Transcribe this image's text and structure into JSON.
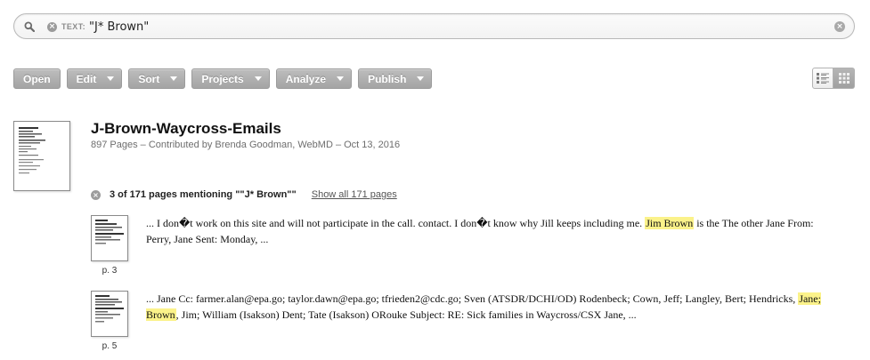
{
  "search": {
    "token_label": "TEXT:",
    "token_value": "\"J* Brown\""
  },
  "toolbar": {
    "buttons": [
      {
        "label": "Open"
      },
      {
        "label": "Edit"
      },
      {
        "label": "Sort"
      },
      {
        "label": "Projects"
      },
      {
        "label": "Analyze"
      },
      {
        "label": "Publish"
      }
    ]
  },
  "document": {
    "title": "J-Brown-Waycross-Emails",
    "meta": "897 Pages – Contributed by Brenda Goodman, WebMD – Oct 13, 2016",
    "mentions_text": "3 of 171 pages mentioning \"\"J* Brown\"\"",
    "show_all_label": "Show all 171 pages"
  },
  "results": [
    {
      "page_label": "p. 3",
      "before": "... I don�t work on this site and will not participate in the call. contact. I don�t know why Jill keeps including me. ",
      "highlight": "Jim Brown",
      "after": " is the The other Jane From: Perry, Jane Sent: Monday, ..."
    },
    {
      "page_label": "p. 5",
      "before": "... Jane Cc: farmer.alan@epa.go; taylor.dawn@epa.go; tfrieden2@cdc.go; Sven (ATSDR/DCHI/OD) Rodenbeck; Cown, Jeff; Langley, Bert; Hendricks, ",
      "highlight": "Jane; Brown",
      "after": ", Jim; William (Isakson) Dent; Tate (Isakson) ORouke Subject: RE: Sick families in Waycross/CSX Jane, ..."
    }
  ],
  "icons": {
    "search": "search-icon",
    "clear": "close-icon",
    "list_view": "list-view-icon",
    "grid_view": "grid-view-icon"
  },
  "colors": {
    "highlight": "#fbf28a",
    "button": "#a8a8a8"
  }
}
